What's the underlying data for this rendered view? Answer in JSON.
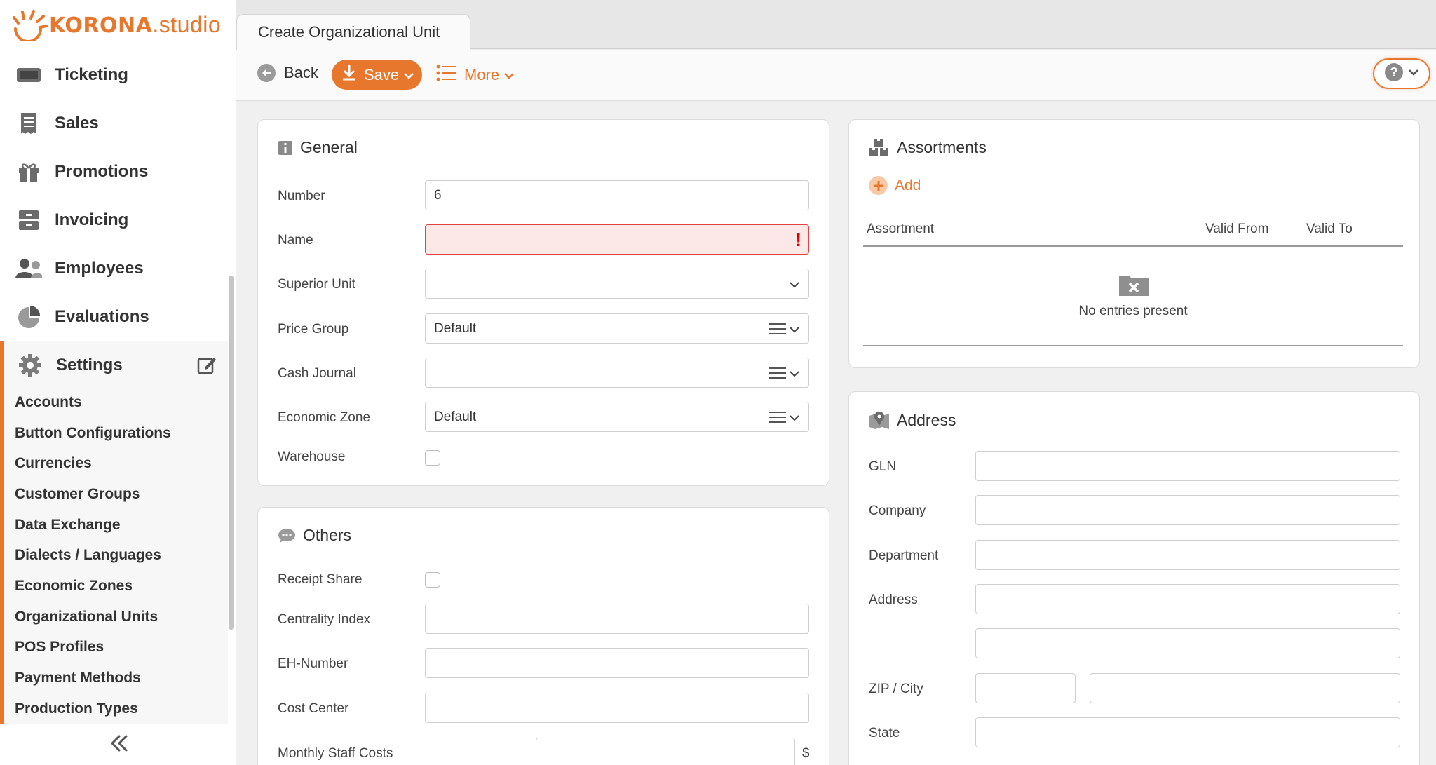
{
  "app": {
    "brand": "KORONA",
    "brand_suffix": ".studio",
    "accent": "#e8772e"
  },
  "sidebar": {
    "items": [
      {
        "label": "Ticketing",
        "icon": "ticket-icon"
      },
      {
        "label": "Sales",
        "icon": "receipt-icon"
      },
      {
        "label": "Promotions",
        "icon": "gift-icon"
      },
      {
        "label": "Invoicing",
        "icon": "archive-icon"
      },
      {
        "label": "Employees",
        "icon": "users-icon"
      },
      {
        "label": "Evaluations",
        "icon": "pie-chart-icon"
      },
      {
        "label": "Settings",
        "icon": "gear-icon"
      }
    ],
    "submenu": [
      "Accounts",
      "Button Configurations",
      "Currencies",
      "Customer Groups",
      "Data Exchange",
      "Dialects / Languages",
      "Economic Zones",
      "Organizational Units",
      "POS Profiles",
      "Payment Methods",
      "Production Types"
    ]
  },
  "tab": {
    "title": "Create Organizational Unit"
  },
  "toolbar": {
    "back": "Back",
    "save": "Save",
    "more": "More"
  },
  "general": {
    "title": "General",
    "number_label": "Number",
    "number_value": "6",
    "name_label": "Name",
    "name_value": "",
    "superior_label": "Superior Unit",
    "superior_value": "",
    "price_group_label": "Price Group",
    "price_group_value": "Default",
    "cash_journal_label": "Cash Journal",
    "cash_journal_value": "",
    "economic_zone_label": "Economic Zone",
    "economic_zone_value": "Default",
    "warehouse_label": "Warehouse",
    "warehouse_checked": false
  },
  "others": {
    "title": "Others",
    "receipt_share_label": "Receipt Share",
    "centrality_label": "Centrality Index",
    "eh_number_label": "EH-Number",
    "cost_center_label": "Cost Center",
    "staff_costs_label": "Monthly Staff Costs",
    "currency_symbol": "$"
  },
  "assortments": {
    "title": "Assortments",
    "add": "Add",
    "columns": [
      "Assortment",
      "Valid From",
      "Valid To"
    ],
    "empty": "No entries present"
  },
  "address": {
    "title": "Address",
    "gln_label": "GLN",
    "company_label": "Company",
    "department_label": "Department",
    "address_label": "Address",
    "zip_city_label": "ZIP / City",
    "state_label": "State"
  }
}
